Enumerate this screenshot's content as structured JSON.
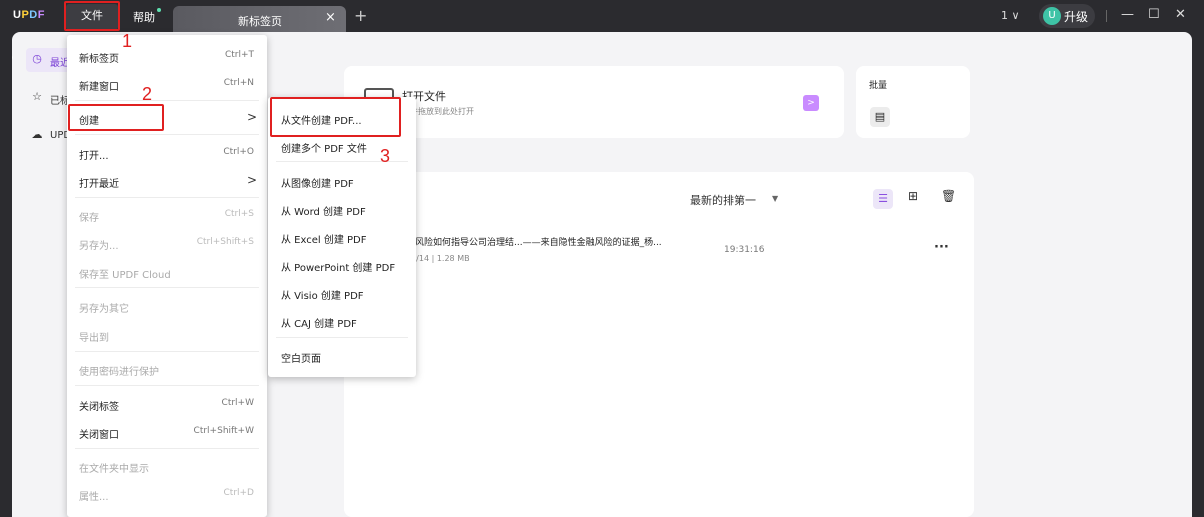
{
  "titlebar": {
    "logo": {
      "p1": "U",
      "p2": "P",
      "p3": "D",
      "p4": "F"
    },
    "menu_file": "文件",
    "menu_help": "帮助",
    "tab_label": "新标签页",
    "tab_close": "×",
    "tab_add": "+",
    "page_indicator": "1 ∨",
    "avatar_letter": "U",
    "upgrade": "升级",
    "minimize": "—",
    "maximize": "☐",
    "close": "✕"
  },
  "sidebar": {
    "items": [
      {
        "label": "最近",
        "icon": "clock-icon"
      },
      {
        "label": "已标",
        "icon": "star-icon"
      },
      {
        "label": "UPD",
        "icon": "cloud-icon"
      }
    ]
  },
  "open_card": {
    "title": "打开文件",
    "subtitle": "文件拖放到此处打开",
    "arrow": ">"
  },
  "batch_card": {
    "title": "批量"
  },
  "files": {
    "sort_label": "最新的排第一",
    "rows": [
      {
        "name": "融风险如何指导公司治理结...——来自隐性金融风险的证据_杨...",
        "meta": "10/14 | 1.28 MB",
        "time": "19:31:16",
        "more": "···"
      }
    ]
  },
  "file_menu": {
    "items": [
      {
        "label": "新标签页",
        "shortcut": "Ctrl+T"
      },
      {
        "label": "新建窗口",
        "shortcut": "Ctrl+N"
      },
      {
        "label": "创建",
        "shortcut": ""
      },
      {
        "label": "打开...",
        "shortcut": "Ctrl+O"
      },
      {
        "label": "打开最近",
        "shortcut": ""
      },
      {
        "label": "保存",
        "shortcut": "Ctrl+S"
      },
      {
        "label": "另存为...",
        "shortcut": "Ctrl+Shift+S"
      },
      {
        "label": "保存至 UPDF Cloud",
        "shortcut": ""
      },
      {
        "label": "另存为其它",
        "shortcut": ""
      },
      {
        "label": "导出到",
        "shortcut": ""
      },
      {
        "label": "使用密码进行保护",
        "shortcut": ""
      },
      {
        "label": "关闭标签",
        "shortcut": "Ctrl+W"
      },
      {
        "label": "关闭窗口",
        "shortcut": "Ctrl+Shift+W"
      },
      {
        "label": "在文件夹中显示",
        "shortcut": ""
      },
      {
        "label": "属性...",
        "shortcut": "Ctrl+D"
      }
    ]
  },
  "create_submenu": {
    "items": [
      "从文件创建 PDF...",
      "创建多个 PDF 文件",
      "从图像创建 PDF",
      "从 Word 创建 PDF",
      "从 Excel 创建 PDF",
      "从 PowerPoint 创建 PDF",
      "从 Visio 创建 PDF",
      "从 CAJ 创建 PDF",
      "空白页面"
    ]
  },
  "annotations": {
    "n1": "1",
    "n2": "2",
    "n3": "3"
  },
  "colors": {
    "accent": "#8a4fe0",
    "annotation": "#e02020",
    "titlebar": "#2b2b2f"
  }
}
